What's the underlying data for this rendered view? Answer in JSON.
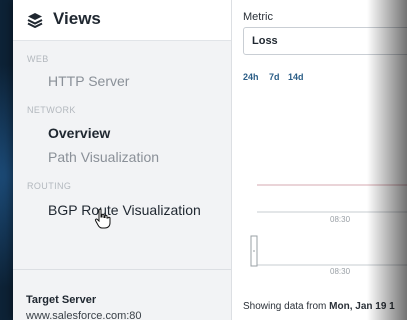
{
  "sidebar": {
    "title": "Views",
    "sections": [
      {
        "label": "WEB",
        "items": [
          {
            "label": "HTTP Server"
          }
        ]
      },
      {
        "label": "NETWORK",
        "items": [
          {
            "label": "Overview"
          },
          {
            "label": "Path Visualization"
          }
        ]
      },
      {
        "label": "ROUTING",
        "items": [
          {
            "label": "BGP Route Visualization"
          }
        ]
      }
    ],
    "target": {
      "label": "Target Server",
      "value": "www.salesforce.com:80"
    }
  },
  "main": {
    "metric_label": "Metric",
    "metric_value": "Loss",
    "ranges": [
      "24h",
      "7d",
      "14d"
    ],
    "chart": {
      "x_tick_top": "08:30",
      "x_tick_bottom": "08:30"
    },
    "status_prefix": "Showing data from ",
    "status_date": "Mon, Jan 19 1"
  },
  "colors": {
    "accent": "#2a5d86",
    "series": "#d6a9b0",
    "background": "#0d2236"
  }
}
